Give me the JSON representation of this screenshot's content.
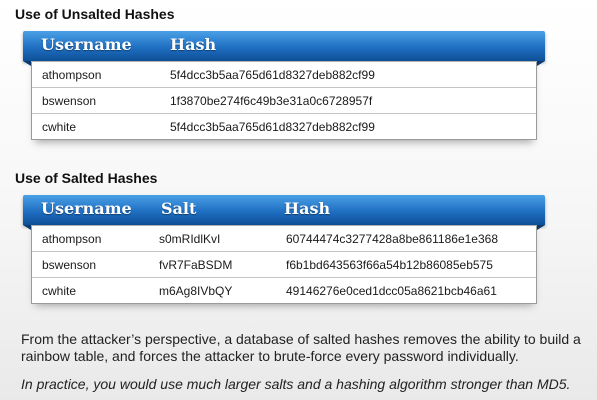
{
  "unsalted": {
    "title": "Use of Unsalted Hashes",
    "headers": {
      "username": "Username",
      "hash": "Hash"
    },
    "rows": [
      {
        "username": "athompson",
        "hash": "5f4dcc3b5aa765d61d8327deb882cf99"
      },
      {
        "username": "bswenson",
        "hash": "1f3870be274f6c49b3e31a0c6728957f"
      },
      {
        "username": "cwhite",
        "hash": "5f4dcc3b5aa765d61d8327deb882cf99"
      }
    ]
  },
  "salted": {
    "title": "Use of Salted Hashes",
    "headers": {
      "username": "Username",
      "salt": "Salt",
      "hash": "Hash"
    },
    "rows": [
      {
        "username": "athompson",
        "salt": "s0mRIdlKvI",
        "hash": "60744474c3277428a8be861186e1e368"
      },
      {
        "username": "bswenson",
        "salt": "fvR7FaBSDM",
        "hash": "f6b1bd643563f66a54b12b86085eb575"
      },
      {
        "username": "cwhite",
        "salt": "m6Ag8IVbQY",
        "hash": "49146276e0ced1dcc05a8621bcb46a61"
      }
    ]
  },
  "body": {
    "paragraph1": "From the attacker’s perspective, a database of salted hashes removes the ability to build a rainbow table, and forces the attacker to brute-force every password individually.",
    "paragraph2": "In practice, you would use much larger salts and a hashing algorithm stronger than MD5."
  }
}
